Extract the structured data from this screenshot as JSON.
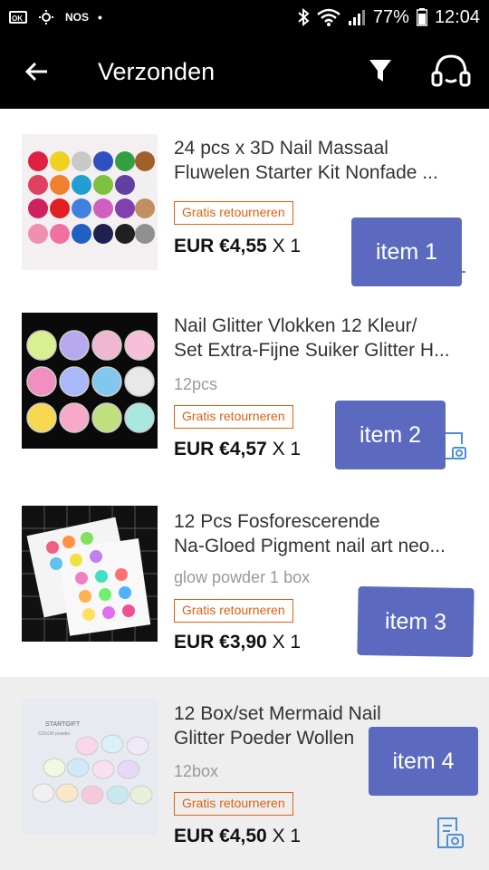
{
  "status_bar": {
    "left_labels": [
      "NOS"
    ],
    "battery": "77%",
    "time": "12:04"
  },
  "app_bar": {
    "title": "Verzonden",
    "icons": [
      "back-arrow-icon",
      "filter-icon",
      "support-headset-icon"
    ]
  },
  "items": [
    {
      "name_line1": "24 pcs x 3D Nail Massaal",
      "name_line2": "Fluwelen Starter Kit Nonfade ...",
      "variant": "",
      "badge": "Gratis retourneren",
      "price": "EUR €4,55",
      "qty": "X 1",
      "overlay": "item 1"
    },
    {
      "name_line1": "Nail Glitter Vlokken 12 Kleur/",
      "name_line2": "Set Extra-Fijne Suiker Glitter H...",
      "variant": "12pcs",
      "badge": "Gratis retourneren",
      "price": "EUR €4,57",
      "qty": "X 1",
      "overlay": "item 2"
    },
    {
      "name_line1": "12 Pcs Fosforescerende",
      "name_line2": "Na-Gloed Pigment nail art neo...",
      "variant": "glow powder 1 box",
      "badge": "Gratis retourneren",
      "price": "EUR €3,90",
      "qty": "X 1",
      "overlay": "item 3"
    },
    {
      "name_line1": "12 Box/set Mermaid Nail",
      "name_line2": "Glitter Poeder Wollen",
      "variant": "12box",
      "badge": "Gratis retourneren",
      "price": "EUR €4,50",
      "qty": "X 1",
      "overlay": "item 4"
    }
  ],
  "thumb4_text": {
    "line1": "STARTGIFT",
    "line2": "COLOR powder"
  },
  "colors": {
    "overlay": "#5b6abf",
    "badge": "#e06010",
    "icon_blue": "#4a8fd8"
  }
}
